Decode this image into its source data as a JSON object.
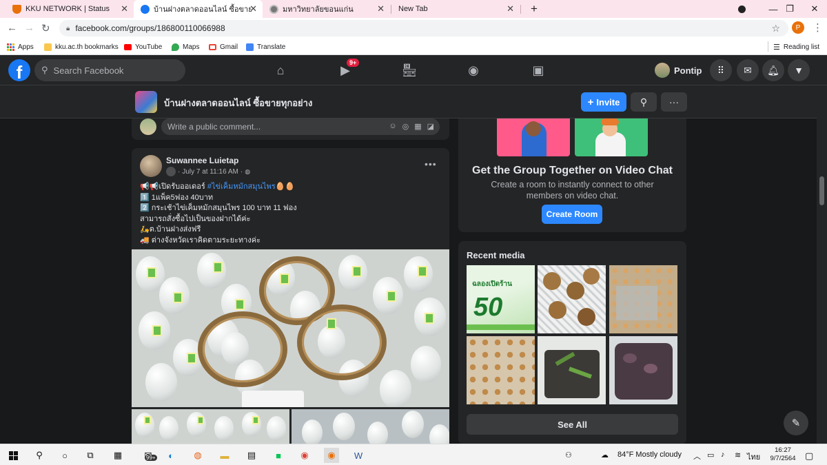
{
  "browser": {
    "tabs": [
      {
        "title": "KKU NETWORK | Status",
        "color": "#e8710a"
      },
      {
        "title": "บ้านฝางตลาดออนไลน์ ซื้อขายทุกอย่าง",
        "color": "#1877f2"
      },
      {
        "title": "มหาวิทยาลัยขอนแก่น",
        "color": "#777777"
      },
      {
        "title": "New Tab",
        "color": ""
      }
    ],
    "new_tab_label": "+",
    "url": "facebook.com/groups/186800110066988",
    "profile_initial": "P",
    "bookmarks": [
      "Apps",
      "kku.ac.th bookmarks",
      "YouTube",
      "Maps",
      "Gmail",
      "Translate"
    ],
    "reading_list": "Reading list"
  },
  "facebook": {
    "logo": "f",
    "search_placeholder": "Search Facebook",
    "watch_badge": "9+",
    "user_name": "Pontip",
    "group_name": "บ้านฝางตลาดออนไลน์ ซื้อขายทุกอย่าง",
    "invite_label": "Invite",
    "comment_placeholder": "Write a public comment...",
    "post": {
      "author": "Suwannee Luietap",
      "time": "July 7 at 11:16 AM",
      "lines": [
        "📢📢เปิดรับออเดอร์ ",
        "1️⃣ 1แพ็ค5ฟอง 40บาท",
        "2️⃣ กระเช้าไข่เค็มหมักสมุนไพร 100 บาท 11 ฟอง",
        "สามารถสั่งซื้อไปเป็นของฝากได้ค่ะ",
        "🛵ต.บ้านฝางส่งฟรี",
        "🚚 ต่างจังหวัดเราคิดตามระยะทางค่ะ"
      ],
      "hashtag": "#ไข่เค็มหมักสมุนไพร",
      "hashtag_suffix": "🥚🥚"
    },
    "video_chat": {
      "title": "Get the Group Together on Video Chat",
      "description": "Create a room to instantly connect to other members on video chat.",
      "button": "Create Room"
    },
    "recent_media": {
      "title": "Recent media",
      "thumb1_text": "ฉลองเปิดร้าน",
      "thumb1_number": "50",
      "see_all": "See All"
    }
  },
  "taskbar": {
    "mail_badge": "99+",
    "weather": "84°F  Mostly cloudy",
    "lang": "ไทย",
    "time": "16:27",
    "date": "9/7/2564"
  }
}
